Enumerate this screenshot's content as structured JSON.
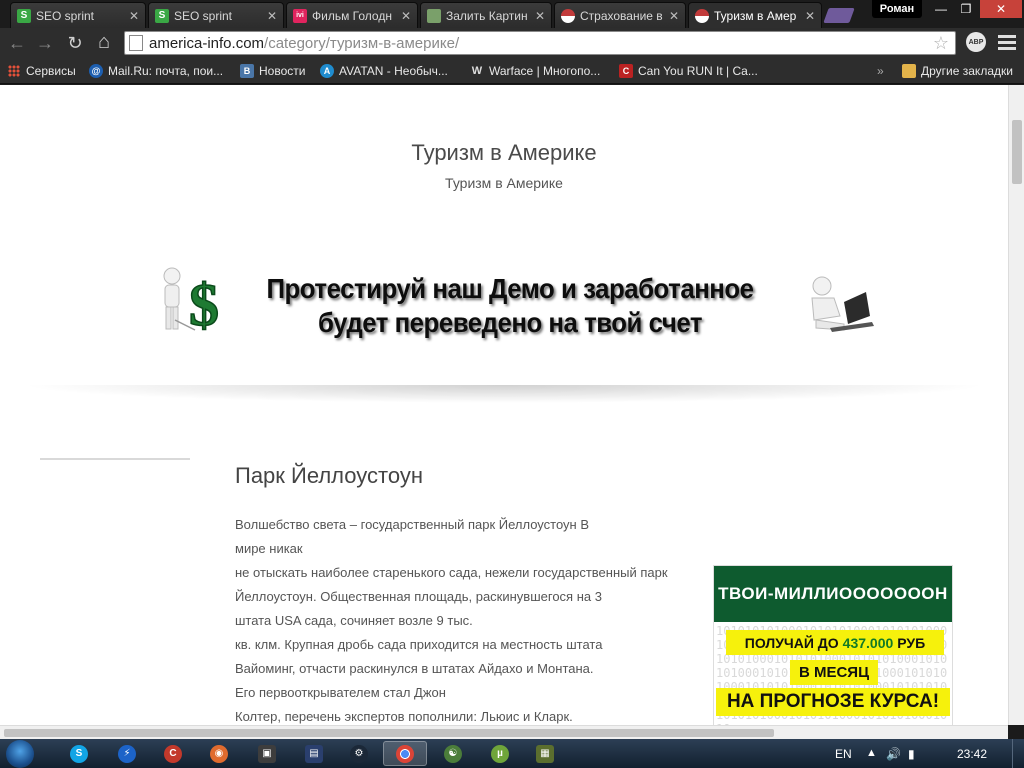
{
  "browser": {
    "tabs": [
      {
        "label": "SEO sprint",
        "favicon": "S",
        "favicon_color": "#3aa845",
        "active": false
      },
      {
        "label": "SEO sprint",
        "favicon": "S",
        "favicon_color": "#3aa845",
        "active": false
      },
      {
        "label": "Фильм Голодн",
        "favicon": "ivi",
        "favicon_color": "#e0245e",
        "active": false
      },
      {
        "label": "Залить Картин",
        "favicon": "",
        "favicon_color": "#7aa06a",
        "active": false
      },
      {
        "label": "Страхование в",
        "favicon": "",
        "favicon_color": "#c23b3b",
        "active": false
      },
      {
        "label": "Туризм в Амер",
        "favicon": "",
        "favicon_color": "#c23b3b",
        "active": true
      }
    ],
    "profile_name": "Роман",
    "window_controls": {
      "minimize": "—",
      "maximize": "❐",
      "close": "✕"
    },
    "nav": {
      "back": "←",
      "forward": "→",
      "reload": "↻",
      "home": "⌂"
    },
    "address": {
      "host": "america-info.com",
      "path": "/category/туризм-в-америке/"
    },
    "star_icon": "☆",
    "abp_label": "ABP",
    "bookmarks": [
      {
        "label": "Сервисы",
        "icon": "apps"
      },
      {
        "label": "Mail.Ru: почта, пои...",
        "icon": "@",
        "color": "#1d5fb0"
      },
      {
        "label": "Новости",
        "icon": "В",
        "color": "#4a76a8"
      },
      {
        "label": "AVATAN - Необыч...",
        "icon": "A",
        "color": "#1f8ccf"
      },
      {
        "label": "Warface | Многопо...",
        "icon": "W",
        "color": "#333333"
      },
      {
        "label": "Can You RUN It | Ca...",
        "icon": "C",
        "color": "#b22"
      }
    ],
    "bookmarks_more": "»",
    "other_bookmarks": "Другие закладки"
  },
  "page": {
    "site_title": "Туризм в Америке",
    "site_description": "Туризм в Америке",
    "banner_line1": "Протестируй наш Демо и заработанное",
    "banner_line2": "будет переведено на твой счет",
    "post": {
      "title": "Парк Йеллоустоун",
      "lines": [
        "Волшебство света – государственный парк Йеллоустоун В",
        "мире никак",
        "не отыскать наиболее старенького сада, нежели государственный парк",
        "Йеллоустоун. Общественная площадь, раскинувшегося на 3",
        "штата USA сада, сочиняет возле 9 тыс.",
        "кв. клм. Крупная дробь сада приходится на местность штата",
        "Вайоминг, отчасти раскинулся в штатах Айдахо и Монтана.",
        "Его первооткрывателем стал Джон",
        "Колтер, перечень экспертов пополнили: Льюис и Кларк."
      ]
    },
    "ad": {
      "headline": "ТВОИ-МИЛЛИОOOOOOOH",
      "line1_prefix": "ПОЛУЧАЙ  ДО",
      "line1_amount": "437.000",
      "line1_suffix": "РУБ",
      "line2": "В МЕСЯЦ",
      "line3": "НА ПРОГНОЗЕ КУРСА!"
    }
  },
  "taskbar": {
    "language": "EN",
    "time": "23:42"
  }
}
